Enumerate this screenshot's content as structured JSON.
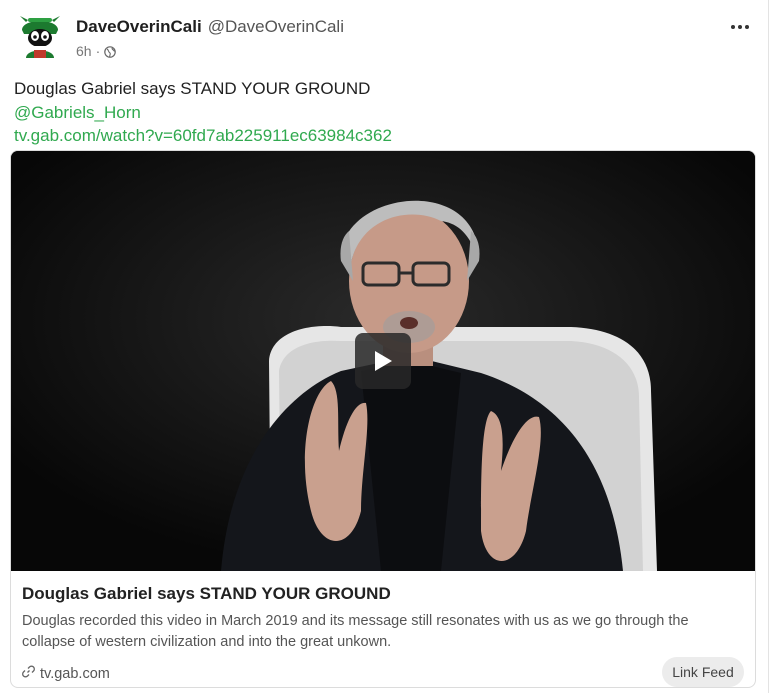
{
  "post": {
    "author_name": "DaveOverinCali",
    "author_handle": "@DaveOverinCali",
    "timestamp": "6h",
    "separator": "·",
    "privacy_icon": "globe-icon",
    "more_icon": "more-horizontal-icon",
    "text_line": "Douglas Gabriel says STAND YOUR GROUND",
    "mention": "@Gabriels_Horn",
    "url": "tv.gab.com/watch?v=60fd7ab225911ec63984c362"
  },
  "card": {
    "title": "Douglas Gabriel says STAND YOUR GROUND",
    "description": "Douglas recorded this video in March 2019 and its message still resonates with us as we go through the collapse of western civilization and into the great unkown.",
    "domain": "tv.gab.com",
    "link_icon": "link-icon",
    "play_icon": "play-icon",
    "link_feed_label": "Link Feed"
  },
  "colors": {
    "link": "#30a94f",
    "text": "#222222",
    "muted": "#555555",
    "video_bg": "#0b0b0b",
    "chip_bg": "#ececec"
  }
}
